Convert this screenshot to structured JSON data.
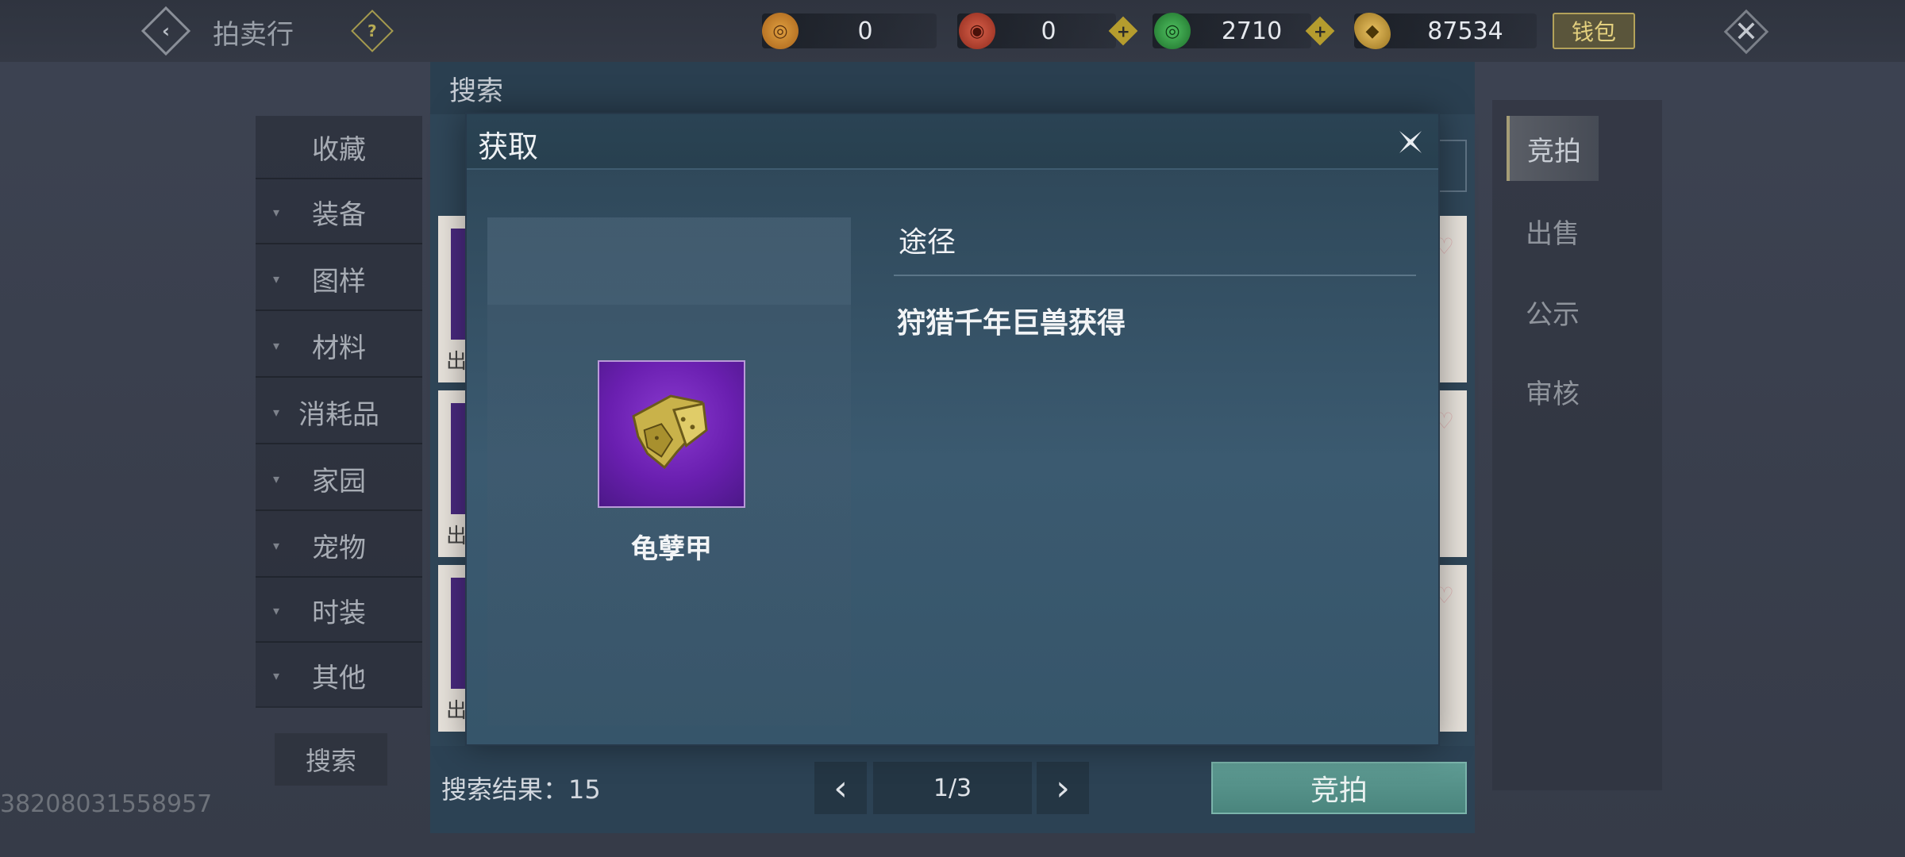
{
  "topbar": {
    "title": "拍卖行",
    "help_icon": "question-icon",
    "currencies": [
      {
        "name": "bronze-coin",
        "value": "0",
        "color": "#c8872a"
      },
      {
        "name": "red-token",
        "value": "0",
        "color": "#b2432f"
      },
      {
        "name": "jade-coin",
        "value": "2710",
        "color": "#2c8f3d"
      },
      {
        "name": "gold-ingot",
        "value": "87534",
        "color": "#c9a23b"
      }
    ],
    "wallet_label": "钱包"
  },
  "categories": [
    "收藏",
    "装备",
    "图样",
    "材料",
    "消耗品",
    "家园",
    "宠物",
    "时装",
    "其他"
  ],
  "side_search_label": "搜索",
  "uid_text": "38208031558957",
  "right_tabs": [
    "竞拍",
    "出售",
    "公示",
    "审核"
  ],
  "main_window": {
    "header": "搜索",
    "results_label": "搜索结果：15",
    "page": "1/3",
    "bid_button": "竞拍",
    "card_label": "出"
  },
  "modal": {
    "title": "获取",
    "item_name": "龟孽甲",
    "source_heading": "途径",
    "sources": [
      "狩猎千年巨兽获得"
    ]
  },
  "colors": {
    "accent_green": "#5f9c94",
    "item_purple": "#6a1fb0",
    "gold": "#b59c2e"
  }
}
